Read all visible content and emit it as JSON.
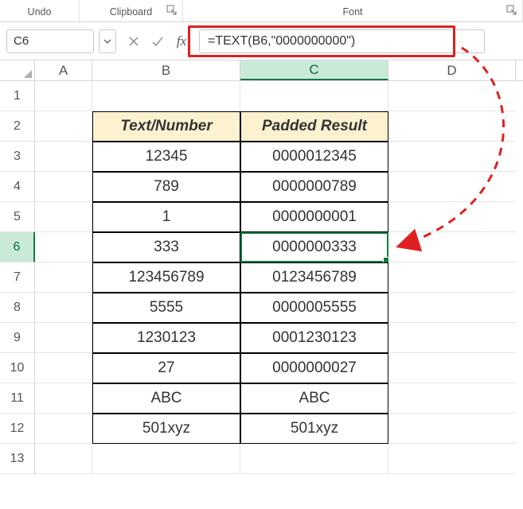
{
  "ribbon": {
    "undo": "Undo",
    "clipboard": "Clipboard",
    "font": "Font"
  },
  "formula_bar": {
    "name_box": "C6",
    "fx_label": "fx",
    "formula": "=TEXT(B6,\"0000000000\")"
  },
  "columns": [
    "A",
    "B",
    "C",
    "D"
  ],
  "active_column": "C",
  "active_row": "6",
  "headers": {
    "B": "Text/Number",
    "C": "Padded Result"
  },
  "rows": [
    {
      "n": "1",
      "B": "",
      "C": ""
    },
    {
      "n": "2",
      "B": "Text/Number",
      "C": "Padded Result",
      "is_header": true
    },
    {
      "n": "3",
      "B": "12345",
      "C": "0000012345"
    },
    {
      "n": "4",
      "B": "789",
      "C": "0000000789"
    },
    {
      "n": "5",
      "B": "1",
      "C": "0000000001"
    },
    {
      "n": "6",
      "B": "333",
      "C": "0000000333"
    },
    {
      "n": "7",
      "B": "123456789",
      "C": "0123456789"
    },
    {
      "n": "8",
      "B": "5555",
      "C": "0000005555"
    },
    {
      "n": "9",
      "B": "1230123",
      "C": "0001230123"
    },
    {
      "n": "10",
      "B": "27",
      "C": "0000000027"
    },
    {
      "n": "11",
      "B": "ABC",
      "C": "ABC"
    },
    {
      "n": "12",
      "B": "501xyz",
      "C": "501xyz"
    },
    {
      "n": "13",
      "B": "",
      "C": ""
    }
  ],
  "colors": {
    "highlight_red": "#e02020",
    "accent_green": "#0f7b42",
    "header_fill": "#fdf2d0"
  }
}
